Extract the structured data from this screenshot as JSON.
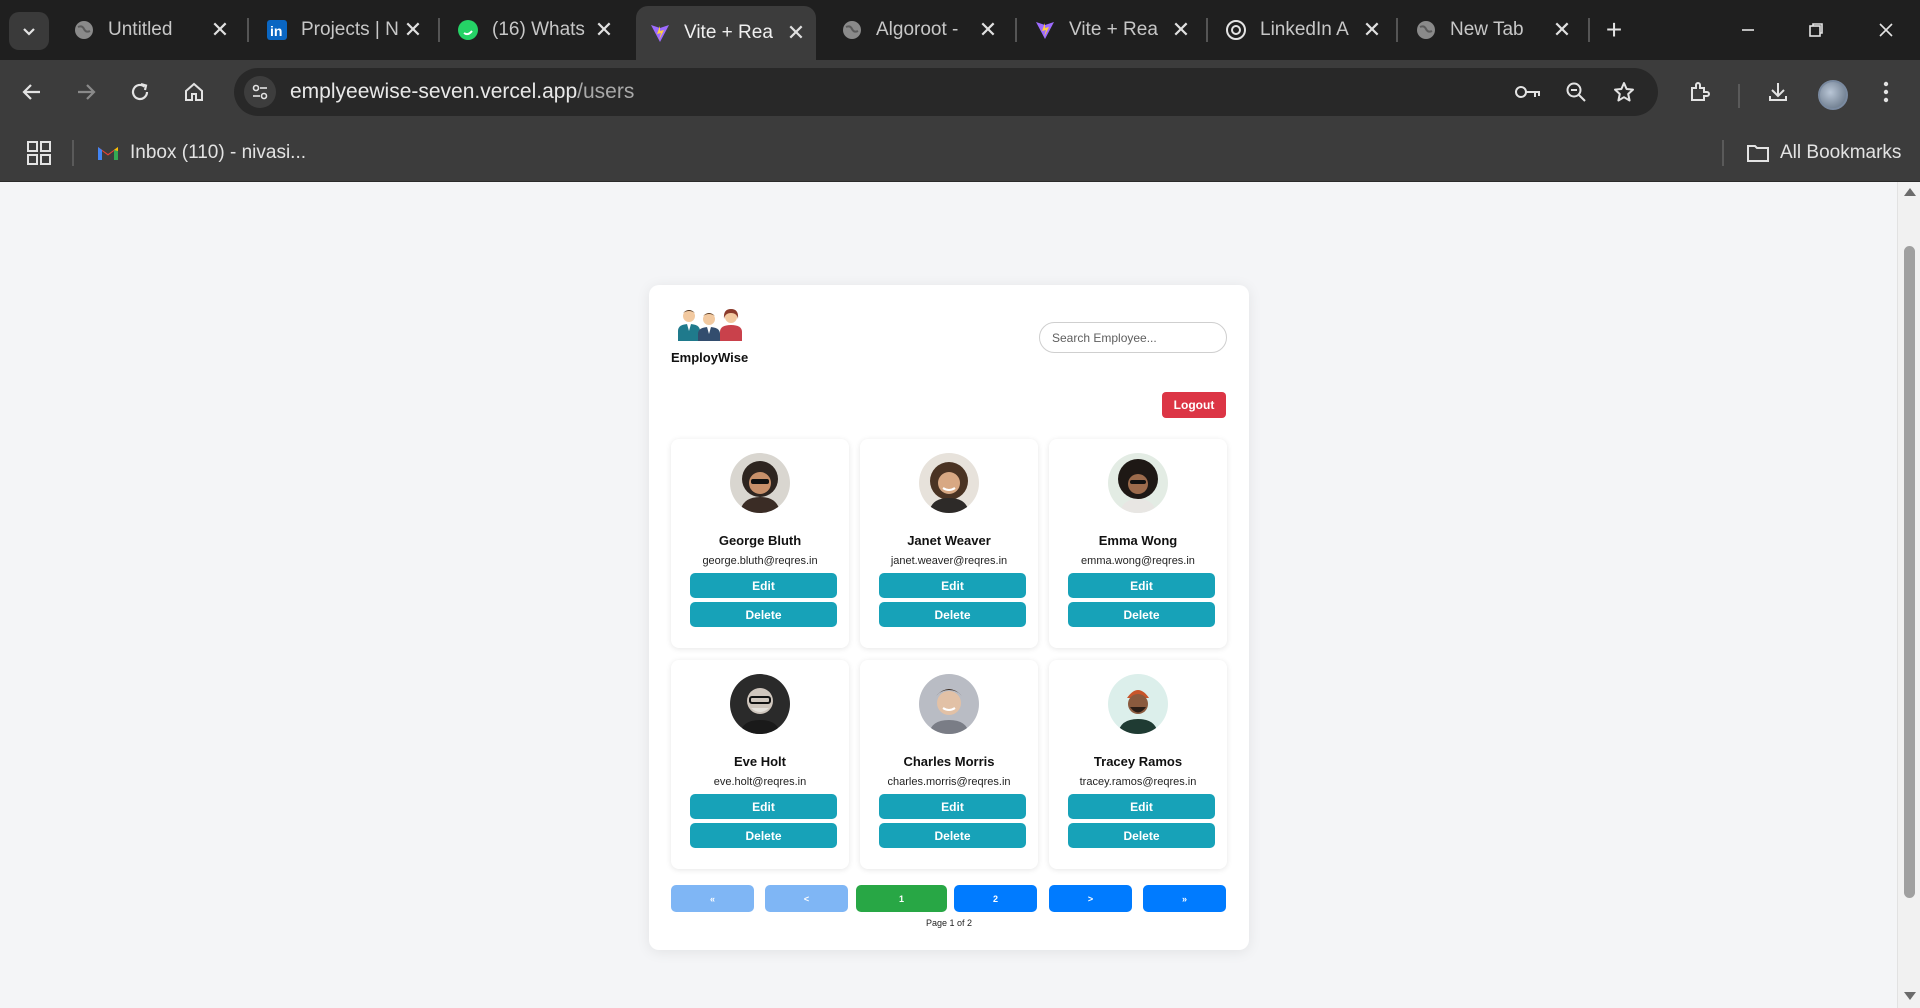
{
  "browser": {
    "tabs": [
      {
        "title": "Untitled",
        "icon": "globe-icon"
      },
      {
        "title": "Projects | N",
        "icon": "linkedin-icon"
      },
      {
        "title": "(16) Whats",
        "icon": "whatsapp-icon"
      },
      {
        "title": "Vite + Rea",
        "icon": "vite-icon",
        "active": true
      },
      {
        "title": "Algoroot -",
        "icon": "globe-icon"
      },
      {
        "title": "Vite + Rea",
        "icon": "vite-icon"
      },
      {
        "title": "LinkedIn A",
        "icon": "chatgpt-icon"
      },
      {
        "title": "New Tab",
        "icon": "globe-icon"
      }
    ],
    "url_host": "emplyeewise-seven.vercel.app",
    "url_path": "/users",
    "bookmarks": [
      {
        "label": "Inbox (110) - nivasi...",
        "icon": "gmail-icon"
      }
    ],
    "all_bookmarks_label": "All Bookmarks"
  },
  "app": {
    "brand": "EmployWise",
    "search_placeholder": "Search Employee...",
    "logout_label": "Logout",
    "edit_label": "Edit",
    "delete_label": "Delete",
    "accent_colors": {
      "edit_delete": "#17a2b8",
      "logout": "#dc3545",
      "current_page": "#28a745",
      "page_button": "#007bff"
    },
    "employees": [
      {
        "name": "George Bluth",
        "email": "george.bluth@reqres.in"
      },
      {
        "name": "Janet Weaver",
        "email": "janet.weaver@reqres.in"
      },
      {
        "name": "Emma Wong",
        "email": "emma.wong@reqres.in"
      },
      {
        "name": "Eve Holt",
        "email": "eve.holt@reqres.in"
      },
      {
        "name": "Charles Morris",
        "email": "charles.morris@reqres.in"
      },
      {
        "name": "Tracey Ramos",
        "email": "tracey.ramos@reqres.in"
      }
    ],
    "pagination": {
      "first": "«",
      "prev": "<",
      "pages": [
        "1",
        "2"
      ],
      "next": ">",
      "last": "»",
      "info": "Page 1 of 2"
    }
  }
}
